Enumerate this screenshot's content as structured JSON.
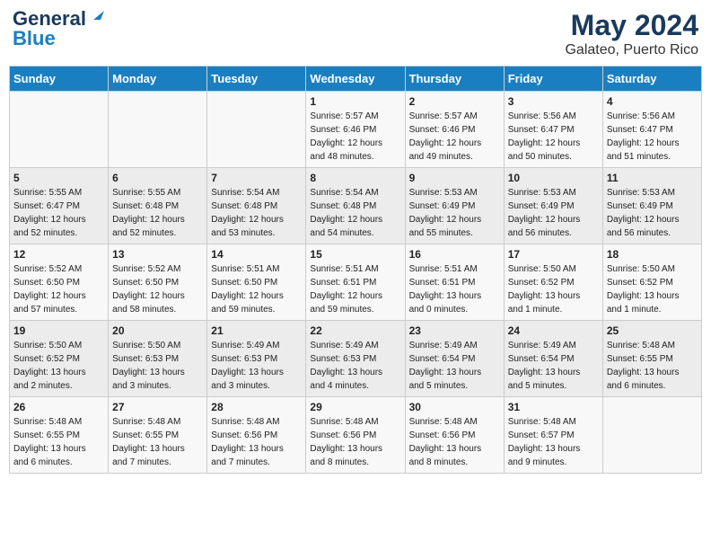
{
  "header": {
    "logo_line1": "General",
    "logo_line2": "Blue",
    "month": "May 2024",
    "location": "Galateo, Puerto Rico"
  },
  "days_of_week": [
    "Sunday",
    "Monday",
    "Tuesday",
    "Wednesday",
    "Thursday",
    "Friday",
    "Saturday"
  ],
  "weeks": [
    [
      {
        "num": "",
        "info": ""
      },
      {
        "num": "",
        "info": ""
      },
      {
        "num": "",
        "info": ""
      },
      {
        "num": "1",
        "info": "Sunrise: 5:57 AM\nSunset: 6:46 PM\nDaylight: 12 hours\nand 48 minutes."
      },
      {
        "num": "2",
        "info": "Sunrise: 5:57 AM\nSunset: 6:46 PM\nDaylight: 12 hours\nand 49 minutes."
      },
      {
        "num": "3",
        "info": "Sunrise: 5:56 AM\nSunset: 6:47 PM\nDaylight: 12 hours\nand 50 minutes."
      },
      {
        "num": "4",
        "info": "Sunrise: 5:56 AM\nSunset: 6:47 PM\nDaylight: 12 hours\nand 51 minutes."
      }
    ],
    [
      {
        "num": "5",
        "info": "Sunrise: 5:55 AM\nSunset: 6:47 PM\nDaylight: 12 hours\nand 52 minutes."
      },
      {
        "num": "6",
        "info": "Sunrise: 5:55 AM\nSunset: 6:48 PM\nDaylight: 12 hours\nand 52 minutes."
      },
      {
        "num": "7",
        "info": "Sunrise: 5:54 AM\nSunset: 6:48 PM\nDaylight: 12 hours\nand 53 minutes."
      },
      {
        "num": "8",
        "info": "Sunrise: 5:54 AM\nSunset: 6:48 PM\nDaylight: 12 hours\nand 54 minutes."
      },
      {
        "num": "9",
        "info": "Sunrise: 5:53 AM\nSunset: 6:49 PM\nDaylight: 12 hours\nand 55 minutes."
      },
      {
        "num": "10",
        "info": "Sunrise: 5:53 AM\nSunset: 6:49 PM\nDaylight: 12 hours\nand 56 minutes."
      },
      {
        "num": "11",
        "info": "Sunrise: 5:53 AM\nSunset: 6:49 PM\nDaylight: 12 hours\nand 56 minutes."
      }
    ],
    [
      {
        "num": "12",
        "info": "Sunrise: 5:52 AM\nSunset: 6:50 PM\nDaylight: 12 hours\nand 57 minutes."
      },
      {
        "num": "13",
        "info": "Sunrise: 5:52 AM\nSunset: 6:50 PM\nDaylight: 12 hours\nand 58 minutes."
      },
      {
        "num": "14",
        "info": "Sunrise: 5:51 AM\nSunset: 6:50 PM\nDaylight: 12 hours\nand 59 minutes."
      },
      {
        "num": "15",
        "info": "Sunrise: 5:51 AM\nSunset: 6:51 PM\nDaylight: 12 hours\nand 59 minutes."
      },
      {
        "num": "16",
        "info": "Sunrise: 5:51 AM\nSunset: 6:51 PM\nDaylight: 13 hours\nand 0 minutes."
      },
      {
        "num": "17",
        "info": "Sunrise: 5:50 AM\nSunset: 6:52 PM\nDaylight: 13 hours\nand 1 minute."
      },
      {
        "num": "18",
        "info": "Sunrise: 5:50 AM\nSunset: 6:52 PM\nDaylight: 13 hours\nand 1 minute."
      }
    ],
    [
      {
        "num": "19",
        "info": "Sunrise: 5:50 AM\nSunset: 6:52 PM\nDaylight: 13 hours\nand 2 minutes."
      },
      {
        "num": "20",
        "info": "Sunrise: 5:50 AM\nSunset: 6:53 PM\nDaylight: 13 hours\nand 3 minutes."
      },
      {
        "num": "21",
        "info": "Sunrise: 5:49 AM\nSunset: 6:53 PM\nDaylight: 13 hours\nand 3 minutes."
      },
      {
        "num": "22",
        "info": "Sunrise: 5:49 AM\nSunset: 6:53 PM\nDaylight: 13 hours\nand 4 minutes."
      },
      {
        "num": "23",
        "info": "Sunrise: 5:49 AM\nSunset: 6:54 PM\nDaylight: 13 hours\nand 5 minutes."
      },
      {
        "num": "24",
        "info": "Sunrise: 5:49 AM\nSunset: 6:54 PM\nDaylight: 13 hours\nand 5 minutes."
      },
      {
        "num": "25",
        "info": "Sunrise: 5:48 AM\nSunset: 6:55 PM\nDaylight: 13 hours\nand 6 minutes."
      }
    ],
    [
      {
        "num": "26",
        "info": "Sunrise: 5:48 AM\nSunset: 6:55 PM\nDaylight: 13 hours\nand 6 minutes."
      },
      {
        "num": "27",
        "info": "Sunrise: 5:48 AM\nSunset: 6:55 PM\nDaylight: 13 hours\nand 7 minutes."
      },
      {
        "num": "28",
        "info": "Sunrise: 5:48 AM\nSunset: 6:56 PM\nDaylight: 13 hours\nand 7 minutes."
      },
      {
        "num": "29",
        "info": "Sunrise: 5:48 AM\nSunset: 6:56 PM\nDaylight: 13 hours\nand 8 minutes."
      },
      {
        "num": "30",
        "info": "Sunrise: 5:48 AM\nSunset: 6:56 PM\nDaylight: 13 hours\nand 8 minutes."
      },
      {
        "num": "31",
        "info": "Sunrise: 5:48 AM\nSunset: 6:57 PM\nDaylight: 13 hours\nand 9 minutes."
      },
      {
        "num": "",
        "info": ""
      }
    ]
  ]
}
